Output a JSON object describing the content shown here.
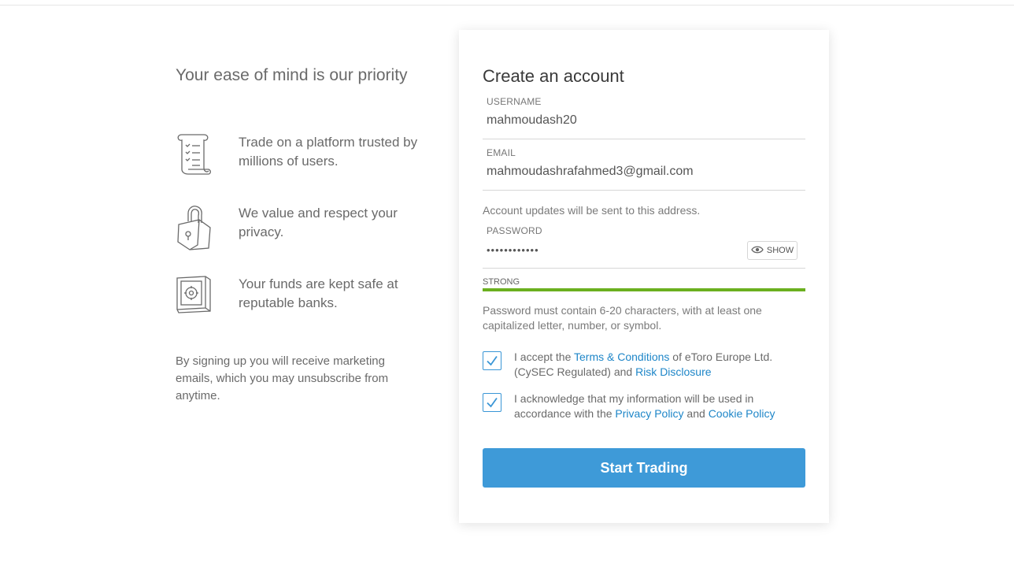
{
  "left": {
    "title": "Your ease of mind is our priority",
    "features": [
      {
        "icon": "scroll-checklist-icon",
        "text": "Trade on a platform trusted by millions of users."
      },
      {
        "icon": "padlock-icon",
        "text": "We value and respect your privacy."
      },
      {
        "icon": "safe-vault-icon",
        "text": "Your funds are kept safe at reputable banks."
      }
    ],
    "marketing": "By signing up you will receive marketing emails, which you may unsubscribe from anytime."
  },
  "form": {
    "title": "Create an account",
    "username": {
      "label": "USERNAME",
      "value": "mahmoudash20"
    },
    "email": {
      "label": "EMAIL",
      "value": "mahmoudashrafahmed3@gmail.com",
      "hint": "Account updates will be sent to this address."
    },
    "password": {
      "label": "PASSWORD",
      "value": "••••••••••••",
      "show_label": "SHOW"
    },
    "strength": {
      "label": "STRONG",
      "level": 1.0,
      "color": "#6bb01f"
    },
    "password_hint": "Password must contain 6-20 characters, with at least one capitalized letter, number, or symbol.",
    "terms": {
      "pre": "I accept the ",
      "link1": "Terms & Conditions",
      "mid": " of eToro Europe Ltd. (CySEC Regulated) and ",
      "link2": "Risk Disclosure",
      "checked": true
    },
    "privacy": {
      "pre": "I acknowledge that my information will be used in accordance with the ",
      "link1": "Privacy Policy",
      "mid": " and ",
      "link2": "Cookie Policy",
      "checked": true
    },
    "submit_label": "Start Trading"
  },
  "colors": {
    "accent": "#3e9ad8",
    "link": "#1e86c8",
    "strong": "#6bb01f"
  }
}
